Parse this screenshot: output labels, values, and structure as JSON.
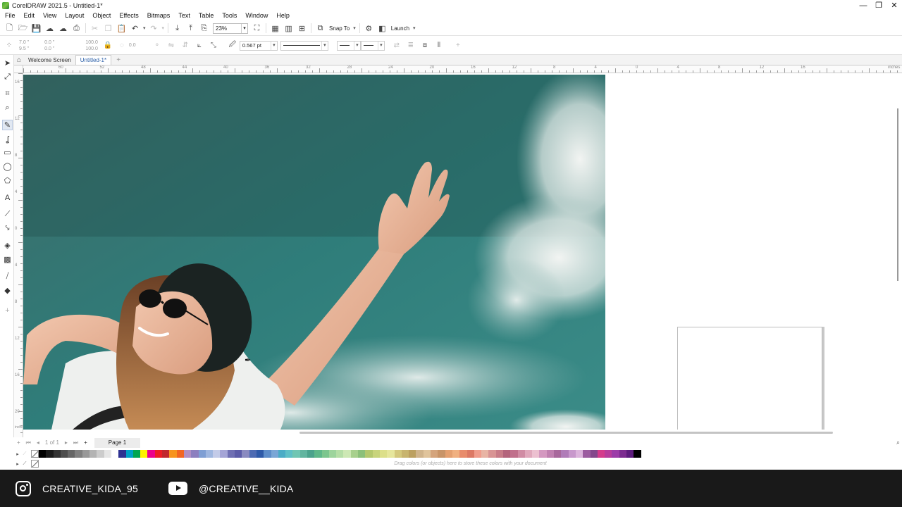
{
  "window": {
    "title": "CorelDRAW 2021.5 - Untitled-1*",
    "controls": [
      "—",
      "❐",
      "✕"
    ]
  },
  "menu": [
    "File",
    "Edit",
    "View",
    "Layout",
    "Object",
    "Effects",
    "Bitmaps",
    "Text",
    "Table",
    "Tools",
    "Window",
    "Help"
  ],
  "standard_toolbar": {
    "zoom_value": "23%",
    "snap_label": "Snap To",
    "launch_label": "Launch"
  },
  "property_bar": {
    "x": "7.0 \"",
    "y": "9.5 \"",
    "w": "0.0 \"",
    "h": "0.0 \"",
    "scale_w": "100.0",
    "scale_h": "100.0",
    "angle": "0.0",
    "outline_width": "0.567 pt"
  },
  "doc_tabs": [
    {
      "label": "Welcome Screen",
      "active": false
    },
    {
      "label": "Untitled-1*",
      "active": true
    }
  ],
  "ruler": {
    "h_labels": [
      "60",
      "52",
      "48",
      "44",
      "40",
      "36",
      "32",
      "28",
      "24",
      "20",
      "16",
      "12",
      "8",
      "4",
      "0",
      "4",
      "8",
      "12",
      "16"
    ],
    "units": "inches",
    "v_labels": [
      "16",
      "12",
      "8",
      "4",
      "0",
      "4",
      "8",
      "12",
      "16",
      "20"
    ],
    "v_units": "inches"
  },
  "page_nav": {
    "page_count": "1 of 1",
    "page_tab": "Page 1"
  },
  "palette": {
    "colors": [
      "#000000",
      "#1a1a1a",
      "#333333",
      "#4d4d4d",
      "#666666",
      "#808080",
      "#999999",
      "#b3b3b3",
      "#cccccc",
      "#e6e6e6",
      "#ffffff",
      "#2e3192",
      "#00a0c6",
      "#00a651",
      "#fff200",
      "#ec008c",
      "#ed1c24",
      "#c1272d",
      "#f7941d",
      "#f26522",
      "#b18fc4",
      "#8c7fbf",
      "#7f9fd4",
      "#9fb7e0",
      "#c3cbe8",
      "#a4a4d6",
      "#6f6fb3",
      "#5c5ca8",
      "#8a8ac0",
      "#4d6bb3",
      "#2e5aa8",
      "#5d8dc9",
      "#7aa6d6",
      "#4bacc6",
      "#5fc0c7",
      "#70c6b3",
      "#62b5a0",
      "#4ca38d",
      "#5fb88a",
      "#7cc68e",
      "#9dd49c",
      "#b5dea6",
      "#cde8b4",
      "#a8d08d",
      "#8cc07a",
      "#b4c86e",
      "#c8d47c",
      "#dcdf8a",
      "#e6e69c",
      "#d4c87c",
      "#c8b46e",
      "#bca060",
      "#d0b48c",
      "#e0c49c",
      "#d4a47c",
      "#c89468",
      "#e4a070",
      "#f0b080",
      "#e88c6c",
      "#dc7864",
      "#f09c8c",
      "#e8b4a4",
      "#d89494",
      "#c87c88",
      "#b4647c",
      "#c0708c",
      "#d08ca4",
      "#e0a8bc",
      "#ecc0d0",
      "#d498c0",
      "#c080b0",
      "#a8689c",
      "#b07cb8",
      "#c898cc",
      "#dcb4dc",
      "#9c5ca0",
      "#84488c",
      "#d43c8c",
      "#b83c9c",
      "#9c3ca8",
      "#7c2c90",
      "#5c1c7c",
      "#000000"
    ],
    "hint": "Drag colors (or objects) here to store these colors with your document"
  },
  "footer": {
    "instagram_handle": "CREATIVE_KIDA_95",
    "youtube_handle": "@CREATIVE__KIDA"
  },
  "icons": {
    "instagram": "instagram-icon",
    "youtube": "youtube-icon"
  }
}
